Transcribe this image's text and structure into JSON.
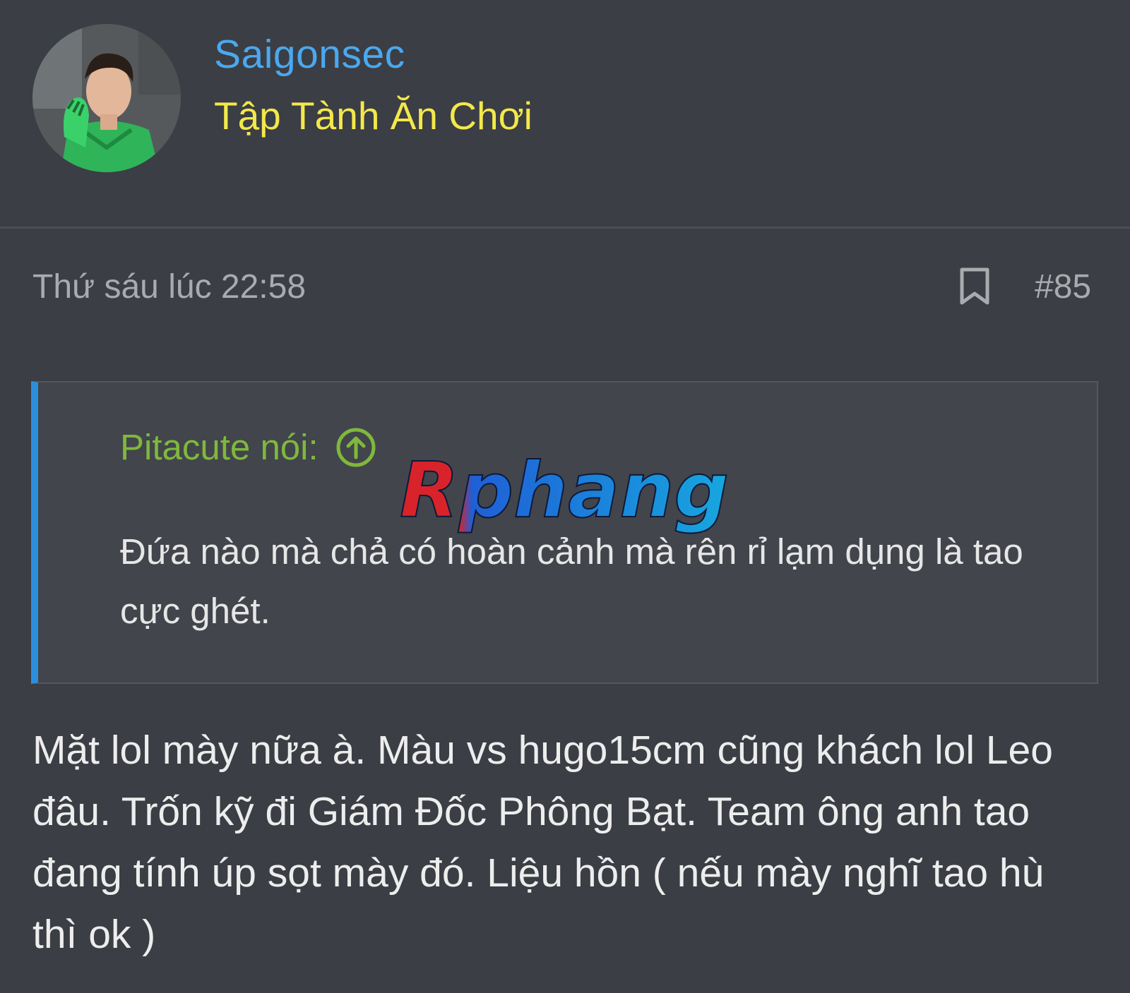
{
  "user": {
    "name": "Saigonsec",
    "title": "Tập Tành Ăn Chơi",
    "avatar_icon": "goalkeeper-avatar"
  },
  "post": {
    "date": "Thứ sáu lúc 22:58",
    "number": "#85",
    "bookmark_icon": "bookmark-icon",
    "body": "Mặt lol mày nữa à. Màu vs hugo15cm cũng khách lol Leo đâu. Trốn kỹ đi Giám Đốc Phông Bạt. Team ông anh tao đang tính úp sọt mày đó. Liệu hồn ( nếu mày nghĩ tao hù thì ok )"
  },
  "quote": {
    "author": "Pitacute nói:",
    "jump_icon": "arrow-up-circle-icon",
    "text": "Đứa nào mà chả có hoàn cảnh mà rên rỉ lạm dụng là tao cực ghét."
  },
  "watermark": {
    "text": "Rphang"
  },
  "colors": {
    "background": "#3b3e44",
    "username": "#4aa8ef",
    "user_title": "#f3e84b",
    "quote_author": "#7fb83c",
    "quote_border": "#2b8fde",
    "meta_text": "#a9abae"
  }
}
